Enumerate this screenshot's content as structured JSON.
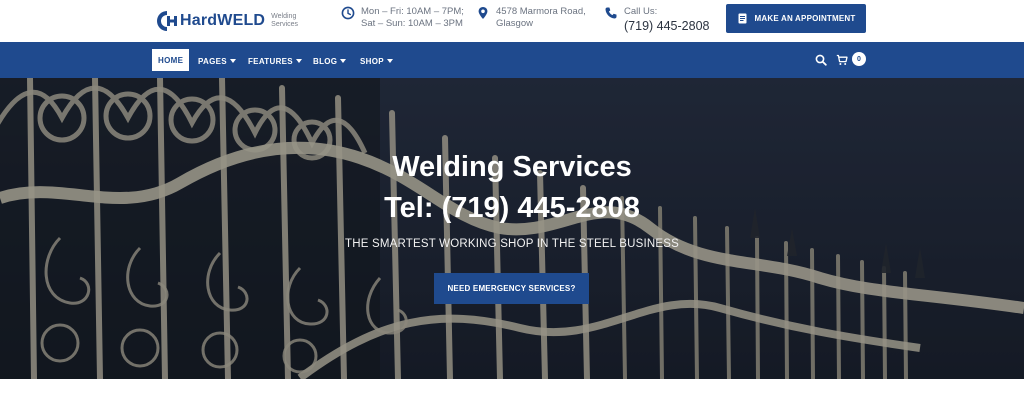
{
  "brand": {
    "name_part1": "Hard",
    "name_part2": "WELD",
    "tagline": "Welding Services",
    "color": "#1f4a8e"
  },
  "header": {
    "hours": {
      "icon": "clock-icon",
      "line1": "Mon – Fri: 10AM – 7PM;",
      "line2": "Sat – Sun: 10AM – 3PM"
    },
    "address": {
      "icon": "map-pin-icon",
      "line1": "4578 Marmora Road,",
      "line2": "Glasgow"
    },
    "phone": {
      "icon": "phone-icon",
      "label": "Call Us:",
      "number": "(719) 445-2808"
    },
    "appointment_button": {
      "icon": "document-icon",
      "label": "MAKE AN APPOINTMENT"
    }
  },
  "nav": {
    "items": [
      {
        "label": "HOME",
        "active": true
      },
      {
        "label": "PAGES",
        "dropdown": true
      },
      {
        "label": "FEATURES",
        "dropdown": true
      },
      {
        "label": "BLOG",
        "dropdown": true
      },
      {
        "label": "SHOP",
        "dropdown": true
      }
    ],
    "search_icon": "search-icon",
    "cart_icon": "cart-icon",
    "cart_count": "0"
  },
  "hero": {
    "title": "Welding Services",
    "phone_line": "Tel: (719) 445-2808",
    "subtitle": "THE SMARTEST WORKING SHOP IN THE STEEL BUSINESS",
    "button_label": "NEED EMERGENCY SERVICES?"
  }
}
